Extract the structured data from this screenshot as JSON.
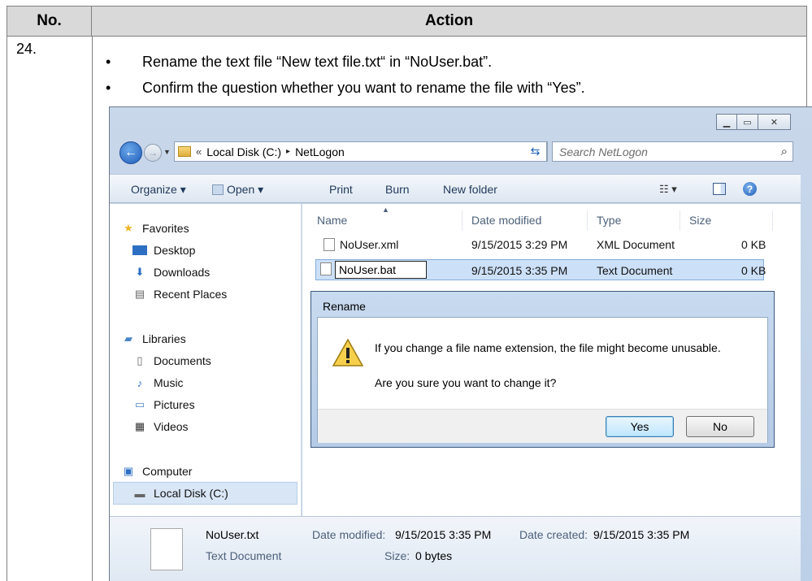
{
  "table": {
    "header_no": "No.",
    "header_action": "Action",
    "step_number": "24.",
    "bullets": [
      "Rename the text file “New text file.txt“ in “NoUser.bat”.",
      "Confirm the question whether you want to rename the file with “Yes”."
    ]
  },
  "explorer": {
    "address": {
      "chevron": "«",
      "segments": [
        "Local Disk (C:)",
        "NetLogon"
      ],
      "separator": "▸"
    },
    "search_placeholder": "Search NetLogon",
    "toolbar": {
      "organize": "Organize ▾",
      "open": "Open ▾",
      "print": "Print",
      "burn": "Burn",
      "new_folder": "New folder"
    },
    "nav": {
      "favorites": "Favorites",
      "desktop": "Desktop",
      "downloads": "Downloads",
      "recent_places": "Recent Places",
      "libraries": "Libraries",
      "documents": "Documents",
      "music": "Music",
      "pictures": "Pictures",
      "videos": "Videos",
      "computer": "Computer",
      "local_disk": "Local Disk (C:)"
    },
    "columns": {
      "name": "Name",
      "date_modified": "Date modified",
      "type": "Type",
      "size": "Size"
    },
    "files": [
      {
        "name": "NoUser.xml",
        "date": "9/15/2015 3:29 PM",
        "type": "XML Document",
        "size": "0 KB"
      },
      {
        "name": "NoUser.bat",
        "date": "9/15/2015 3:35 PM",
        "type": "Text Document",
        "size": "0 KB"
      }
    ],
    "details": {
      "file_name": "NoUser.txt",
      "file_type": "Text Document",
      "modified_label": "Date modified:",
      "modified_value": "9/15/2015 3:35 PM",
      "size_label": "Size:",
      "size_value": "0 bytes",
      "created_label": "Date created:",
      "created_value": "9/15/2015 3:35 PM"
    }
  },
  "dialog": {
    "title": "Rename",
    "message": "If you change a file name extension, the file might become unusable.",
    "question": "Are you sure you want to change it?",
    "yes": "Yes",
    "no": "No"
  },
  "colors": {
    "header_bg": "#d9d9d9",
    "selection": "#cce0f7",
    "accent": "#1f5db8"
  }
}
